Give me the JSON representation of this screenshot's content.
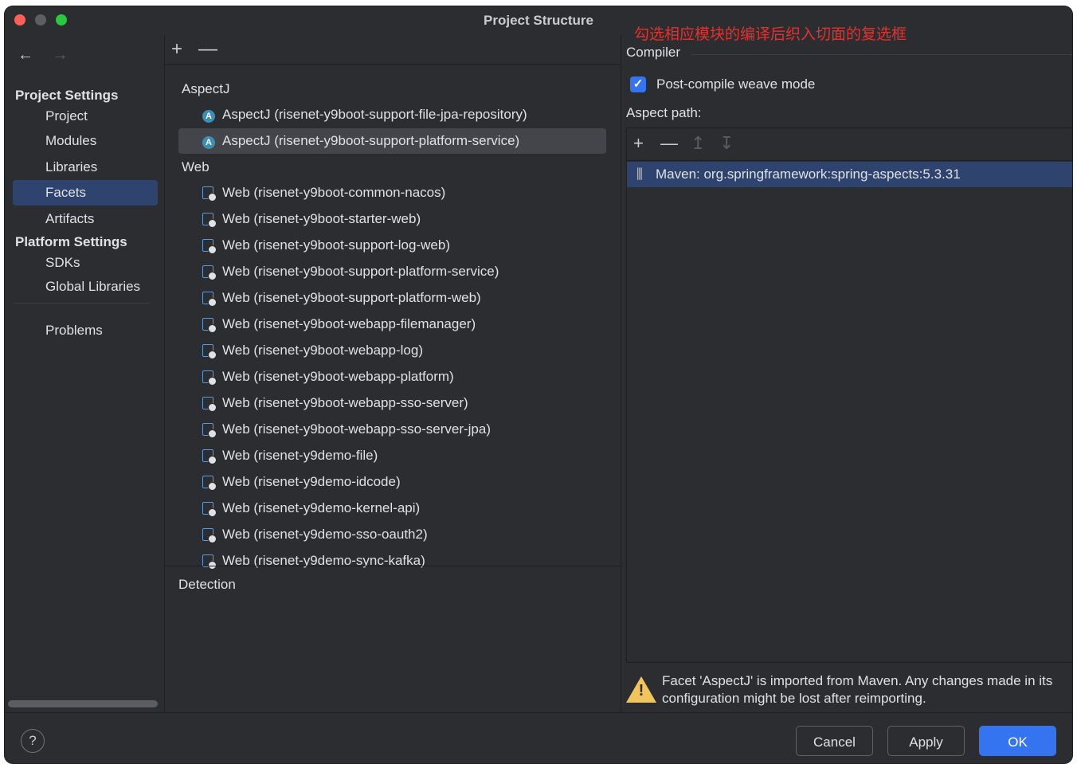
{
  "window": {
    "title": "Project Structure",
    "annotation": "勾选相应模块的编译后织入切面的复选框"
  },
  "nav": {
    "back": "←",
    "forward": "→"
  },
  "sidebar": {
    "project_settings_header": "Project Settings",
    "project_items": [
      {
        "label": "Project",
        "selected": false
      },
      {
        "label": "Modules",
        "selected": false
      },
      {
        "label": "Libraries",
        "selected": false
      },
      {
        "label": "Facets",
        "selected": true
      },
      {
        "label": "Artifacts",
        "selected": false
      }
    ],
    "platform_settings_header": "Platform Settings",
    "platform_items": [
      {
        "label": "SDKs"
      },
      {
        "label": "Global Libraries"
      }
    ],
    "problems": "Problems"
  },
  "facets": {
    "toolbar": {
      "add": "+",
      "remove": "—"
    },
    "aspectj_group": "AspectJ",
    "aspectj_items": [
      {
        "label": "AspectJ (risenet-y9boot-support-file-jpa-repository)",
        "selected": false,
        "icon": "aspectj-icon"
      },
      {
        "label": "AspectJ (risenet-y9boot-support-platform-service)",
        "selected": true,
        "icon": "aspectj-icon"
      }
    ],
    "web_group": "Web",
    "web_items": [
      {
        "label": "Web (risenet-y9boot-common-nacos)"
      },
      {
        "label": "Web (risenet-y9boot-starter-web)"
      },
      {
        "label": "Web (risenet-y9boot-support-log-web)"
      },
      {
        "label": "Web (risenet-y9boot-support-platform-service)"
      },
      {
        "label": "Web (risenet-y9boot-support-platform-web)"
      },
      {
        "label": "Web (risenet-y9boot-webapp-filemanager)"
      },
      {
        "label": "Web (risenet-y9boot-webapp-log)"
      },
      {
        "label": "Web (risenet-y9boot-webapp-platform)"
      },
      {
        "label": "Web (risenet-y9boot-webapp-sso-server)"
      },
      {
        "label": "Web (risenet-y9boot-webapp-sso-server-jpa)"
      },
      {
        "label": "Web (risenet-y9demo-file)"
      },
      {
        "label": "Web (risenet-y9demo-idcode)"
      },
      {
        "label": "Web (risenet-y9demo-kernel-api)"
      },
      {
        "label": "Web (risenet-y9demo-sso-oauth2)"
      },
      {
        "label": "Web (risenet-y9demo-sync-kafka)"
      }
    ],
    "detection": "Detection"
  },
  "compiler": {
    "section_label": "Compiler",
    "post_compile_label": "Post-compile weave mode",
    "post_compile_checked": true,
    "aspect_path_label": "Aspect path:",
    "aspect_toolbar": {
      "add": "+",
      "remove": "—",
      "move_up": "↥",
      "move_down": "↧"
    },
    "aspect_paths": [
      "Maven: org.springframework:spring-aspects:5.3.31"
    ],
    "warning": "Facet 'AspectJ' is imported from Maven. Any changes made in its configuration might be lost after reimporting."
  },
  "footer": {
    "help": "?",
    "cancel": "Cancel",
    "apply": "Apply",
    "ok": "OK"
  },
  "colors": {
    "background": "#2b2d30",
    "selection": "#2e436e",
    "accent": "#3574f0",
    "annotation": "#e8302c",
    "warning": "#f2c55c"
  }
}
